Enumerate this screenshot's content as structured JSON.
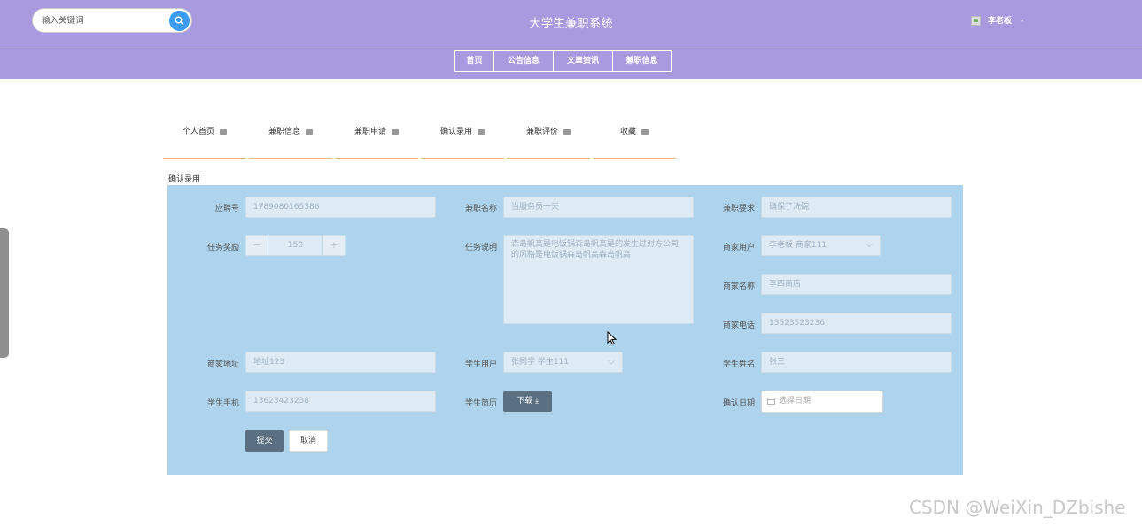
{
  "header": {
    "search_placeholder": "输入关键词",
    "site_title": "大学生兼职系统",
    "username": "李老板",
    "user_caret": "-",
    "bg_color": "#a99ae0"
  },
  "topnav": [
    "首页",
    "公告信息",
    "文章资讯",
    "兼职信息"
  ],
  "tabs": [
    "个人首页",
    "兼职信息",
    "兼职申请",
    "确认录用",
    "兼职评价",
    "收藏"
  ],
  "section_title": "确认录用",
  "form": {
    "bg_color": "#aed3ec",
    "application_no_label": "应聘号",
    "application_no": "1789080165386",
    "job_name_label": "兼职名称",
    "job_name": "当服务员一天",
    "job_req_label": "兼职要求",
    "job_req": "确保了洗碗",
    "reward_label": "任务奖励",
    "reward_minus": "−",
    "reward_value": "150",
    "reward_plus": "+",
    "task_desc_label": "任务说明",
    "task_desc": "森岛帆高是电饭锅森岛帆高是的发生过对方公司的风格是电饭锅森岛帆高森岛帆高",
    "merchant_user_label": "商家用户",
    "merchant_user": "李老板 商家111",
    "merchant_name_label": "商家名称",
    "merchant_name": "李四商店",
    "merchant_phone_label": "商家电话",
    "merchant_phone": "13523523236",
    "merchant_addr_label": "商家地址",
    "merchant_addr": "地址123",
    "student_user_label": "学生用户",
    "student_user": "张同学 学生111",
    "student_name_label": "学生姓名",
    "student_name": "张三",
    "student_phone_label": "学生手机",
    "student_phone": "13623423238",
    "resume_label": "学生简历",
    "download_label": "下载 ⤓",
    "confirm_date_label": "确认日期",
    "date_placeholder": "选择日期",
    "submit_label": "提交",
    "cancel_label": "取消"
  },
  "watermark": "CSDN @WeiXin_DZbishe"
}
